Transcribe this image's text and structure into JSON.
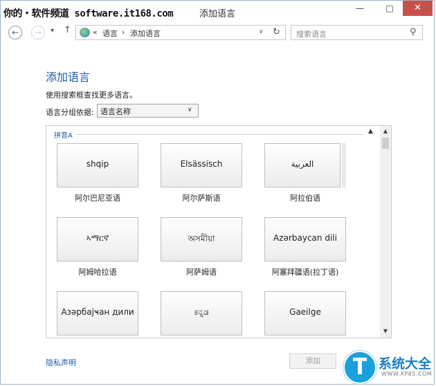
{
  "watermark": "你的・软件频道 software.it168.com",
  "window": {
    "title": "添加语言",
    "min_glyph": "—",
    "max_glyph": "□",
    "close_glyph": "✕"
  },
  "nav": {
    "back_glyph": "←",
    "forward_glyph": "→",
    "recent_glyph": "▾",
    "up_glyph": "↑",
    "address": {
      "prefix": "«",
      "crumb1": "语言",
      "sep": "›",
      "crumb2": "添加语言",
      "dropdown_glyph": "∨",
      "refresh_glyph": "↻"
    },
    "search_placeholder": "搜索语言",
    "search_glyph": "⚲"
  },
  "main": {
    "heading": "添加语言",
    "hint": "使用搜索框查找更多语言。",
    "group_by_label": "语言分组依据:",
    "group_by_value": "语言名称",
    "group_by_arrow": "∨"
  },
  "list": {
    "group_header": "拼音A",
    "collapse_glyph": "▲",
    "scroll_up_glyph": "▲",
    "scroll_down_glyph": "▼",
    "tiles": [
      {
        "sample": "shqip",
        "name": "阿尔巴尼亚语"
      },
      {
        "sample": "Elsässisch",
        "name": "阿尔萨斯语"
      },
      {
        "sample": "العربية",
        "name": "阿拉伯语",
        "stacked": true
      },
      {
        "sample": "ኣማርኛ",
        "name": "阿姆哈拉语"
      },
      {
        "sample": "অসমীয়া",
        "name": "阿萨姆语"
      },
      {
        "sample": "Azərbaycan dili",
        "name": "阿塞拜疆语(拉丁语)"
      },
      {
        "sample": "Азәрбајҹан дили",
        "name": ""
      },
      {
        "sample": "ಕನ್ನಡ",
        "name": ""
      },
      {
        "sample": "Gaeilge",
        "name": ""
      }
    ]
  },
  "footer": {
    "privacy": "隐私声明",
    "add_button": "添加",
    "logo_brand": "系统大全",
    "logo_site": "WWW.XP85.COM"
  }
}
